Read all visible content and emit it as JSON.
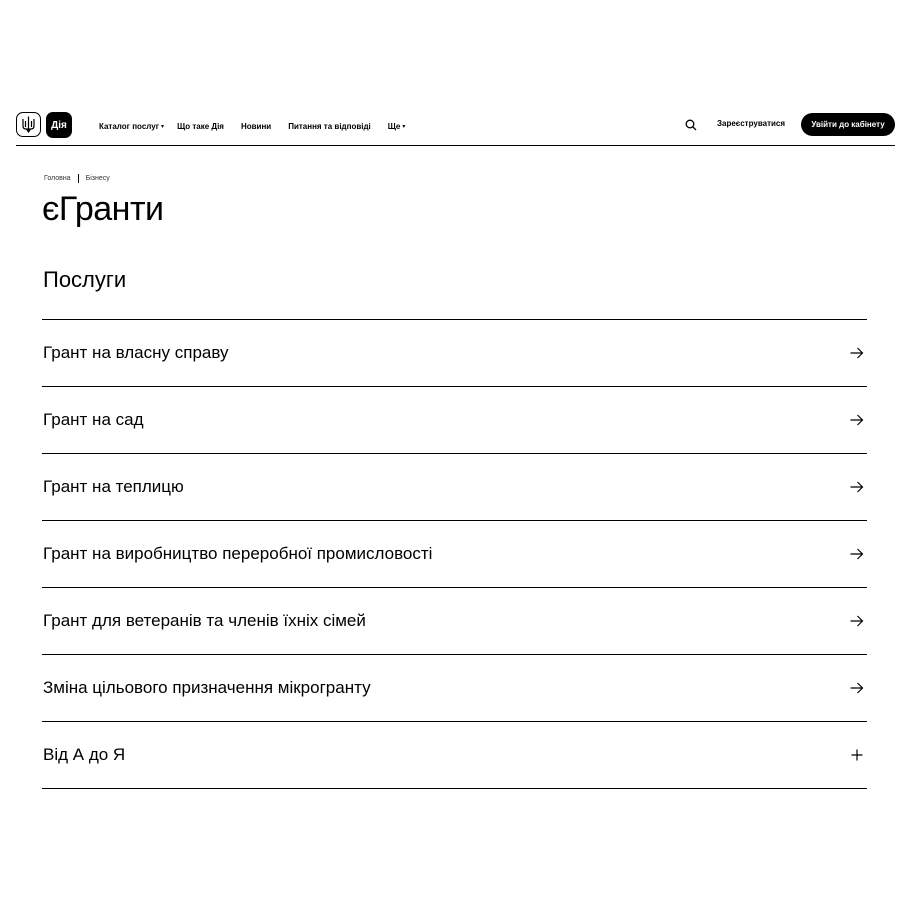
{
  "header": {
    "logo_text": "Дія",
    "nav": [
      {
        "label": "Каталог послуг",
        "has_dropdown": true
      },
      {
        "label": "Що таке Дія",
        "has_dropdown": false
      },
      {
        "label": "Новини",
        "has_dropdown": false
      },
      {
        "label": "Питання та відповіді",
        "has_dropdown": false
      },
      {
        "label": "Ще",
        "has_dropdown": true
      }
    ],
    "register_label": "Зареєструватися",
    "login_label": "Увійти до кабінету"
  },
  "breadcrumb": {
    "home": "Головна",
    "current": "Бізнесу"
  },
  "page": {
    "title": "єГранти",
    "section_title": "Послуги"
  },
  "services": [
    {
      "label": "Грант на власну справу",
      "icon": "arrow-right-icon"
    },
    {
      "label": "Грант на сад",
      "icon": "arrow-right-icon"
    },
    {
      "label": "Грант на теплицю",
      "icon": "arrow-right-icon"
    },
    {
      "label": "Грант на виробництво переробної промисловості",
      "icon": "arrow-right-icon"
    },
    {
      "label": "Грант для ветеранів та членів їхніх сімей",
      "icon": "arrow-right-icon"
    },
    {
      "label": "Зміна цільового призначення мікрогранту",
      "icon": "arrow-right-icon"
    },
    {
      "label": "Від А до Я",
      "icon": "plus-icon"
    }
  ],
  "colors": {
    "text": "#000000",
    "background": "#ffffff",
    "button_bg": "#000000",
    "button_text": "#ffffff"
  }
}
